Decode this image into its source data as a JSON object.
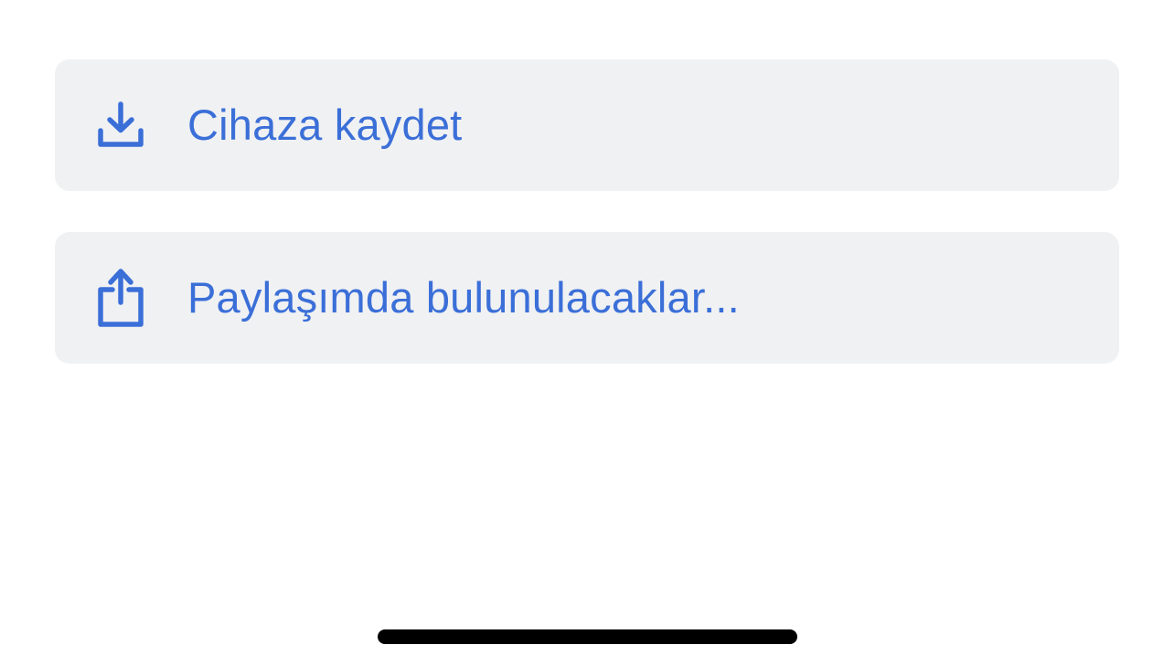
{
  "colors": {
    "accent": "#3b6fd8",
    "row_background": "#f0f1f3",
    "page_background": "#ffffff",
    "home_indicator": "#000000"
  },
  "actions": [
    {
      "label": "Cihaza kaydet",
      "icon": "download-icon"
    },
    {
      "label": "Paylaşımda bulunulacaklar...",
      "icon": "share-icon"
    }
  ]
}
